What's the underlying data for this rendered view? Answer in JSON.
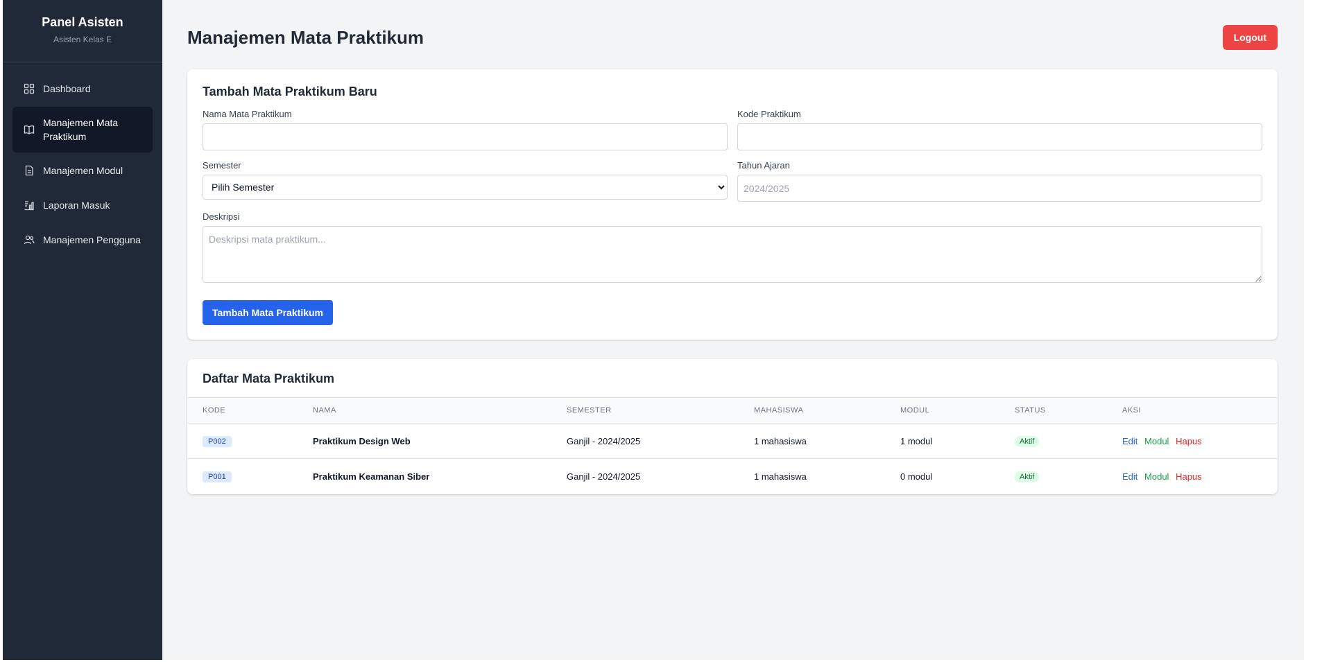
{
  "sidebar": {
    "title": "Panel Asisten",
    "subtitle": "Asisten Kelas E",
    "items": [
      {
        "label": "Dashboard",
        "icon": "dashboard-grid-icon"
      },
      {
        "label": "Manajemen Mata Praktikum",
        "icon": "book-icon",
        "active": true
      },
      {
        "label": "Manajemen Modul",
        "icon": "document-icon"
      },
      {
        "label": "Laporan Masuk",
        "icon": "report-icon"
      },
      {
        "label": "Manajemen Pengguna",
        "icon": "users-icon"
      }
    ]
  },
  "header": {
    "title": "Manajemen Mata Praktikum",
    "logout_label": "Logout"
  },
  "form": {
    "title": "Tambah Mata Praktikum Baru",
    "nama_label": "Nama Mata Praktikum",
    "nama_value": "",
    "kode_label": "Kode Praktikum",
    "kode_value": "",
    "semester_label": "Semester",
    "semester_selected": "Pilih Semester",
    "tahun_label": "Tahun Ajaran",
    "tahun_placeholder": "2024/2025",
    "deskripsi_label": "Deskripsi",
    "deskripsi_placeholder": "Deskripsi mata praktikum...",
    "submit_label": "Tambah Mata Praktikum"
  },
  "list": {
    "title": "Daftar Mata Praktikum",
    "columns": [
      "KODE",
      "NAMA",
      "SEMESTER",
      "MAHASISWA",
      "MODUL",
      "STATUS",
      "AKSI"
    ],
    "rows": [
      {
        "kode": "P002",
        "nama": "Praktikum Design Web",
        "semester": "Ganjil - 2024/2025",
        "mahasiswa": "1 mahasiswa",
        "modul": "1 modul",
        "status": "Aktif"
      },
      {
        "kode": "P001",
        "nama": "Praktikum Keamanan Siber",
        "semester": "Ganjil - 2024/2025",
        "mahasiswa": "1 mahasiswa",
        "modul": "0 modul",
        "status": "Aktif"
      }
    ],
    "actions": {
      "edit": "Edit",
      "modul": "Modul",
      "hapus": "Hapus"
    }
  },
  "colors": {
    "sidebar_bg": "#1f2937",
    "primary": "#2563eb",
    "danger": "#ef4444",
    "success": "#16a34a"
  }
}
